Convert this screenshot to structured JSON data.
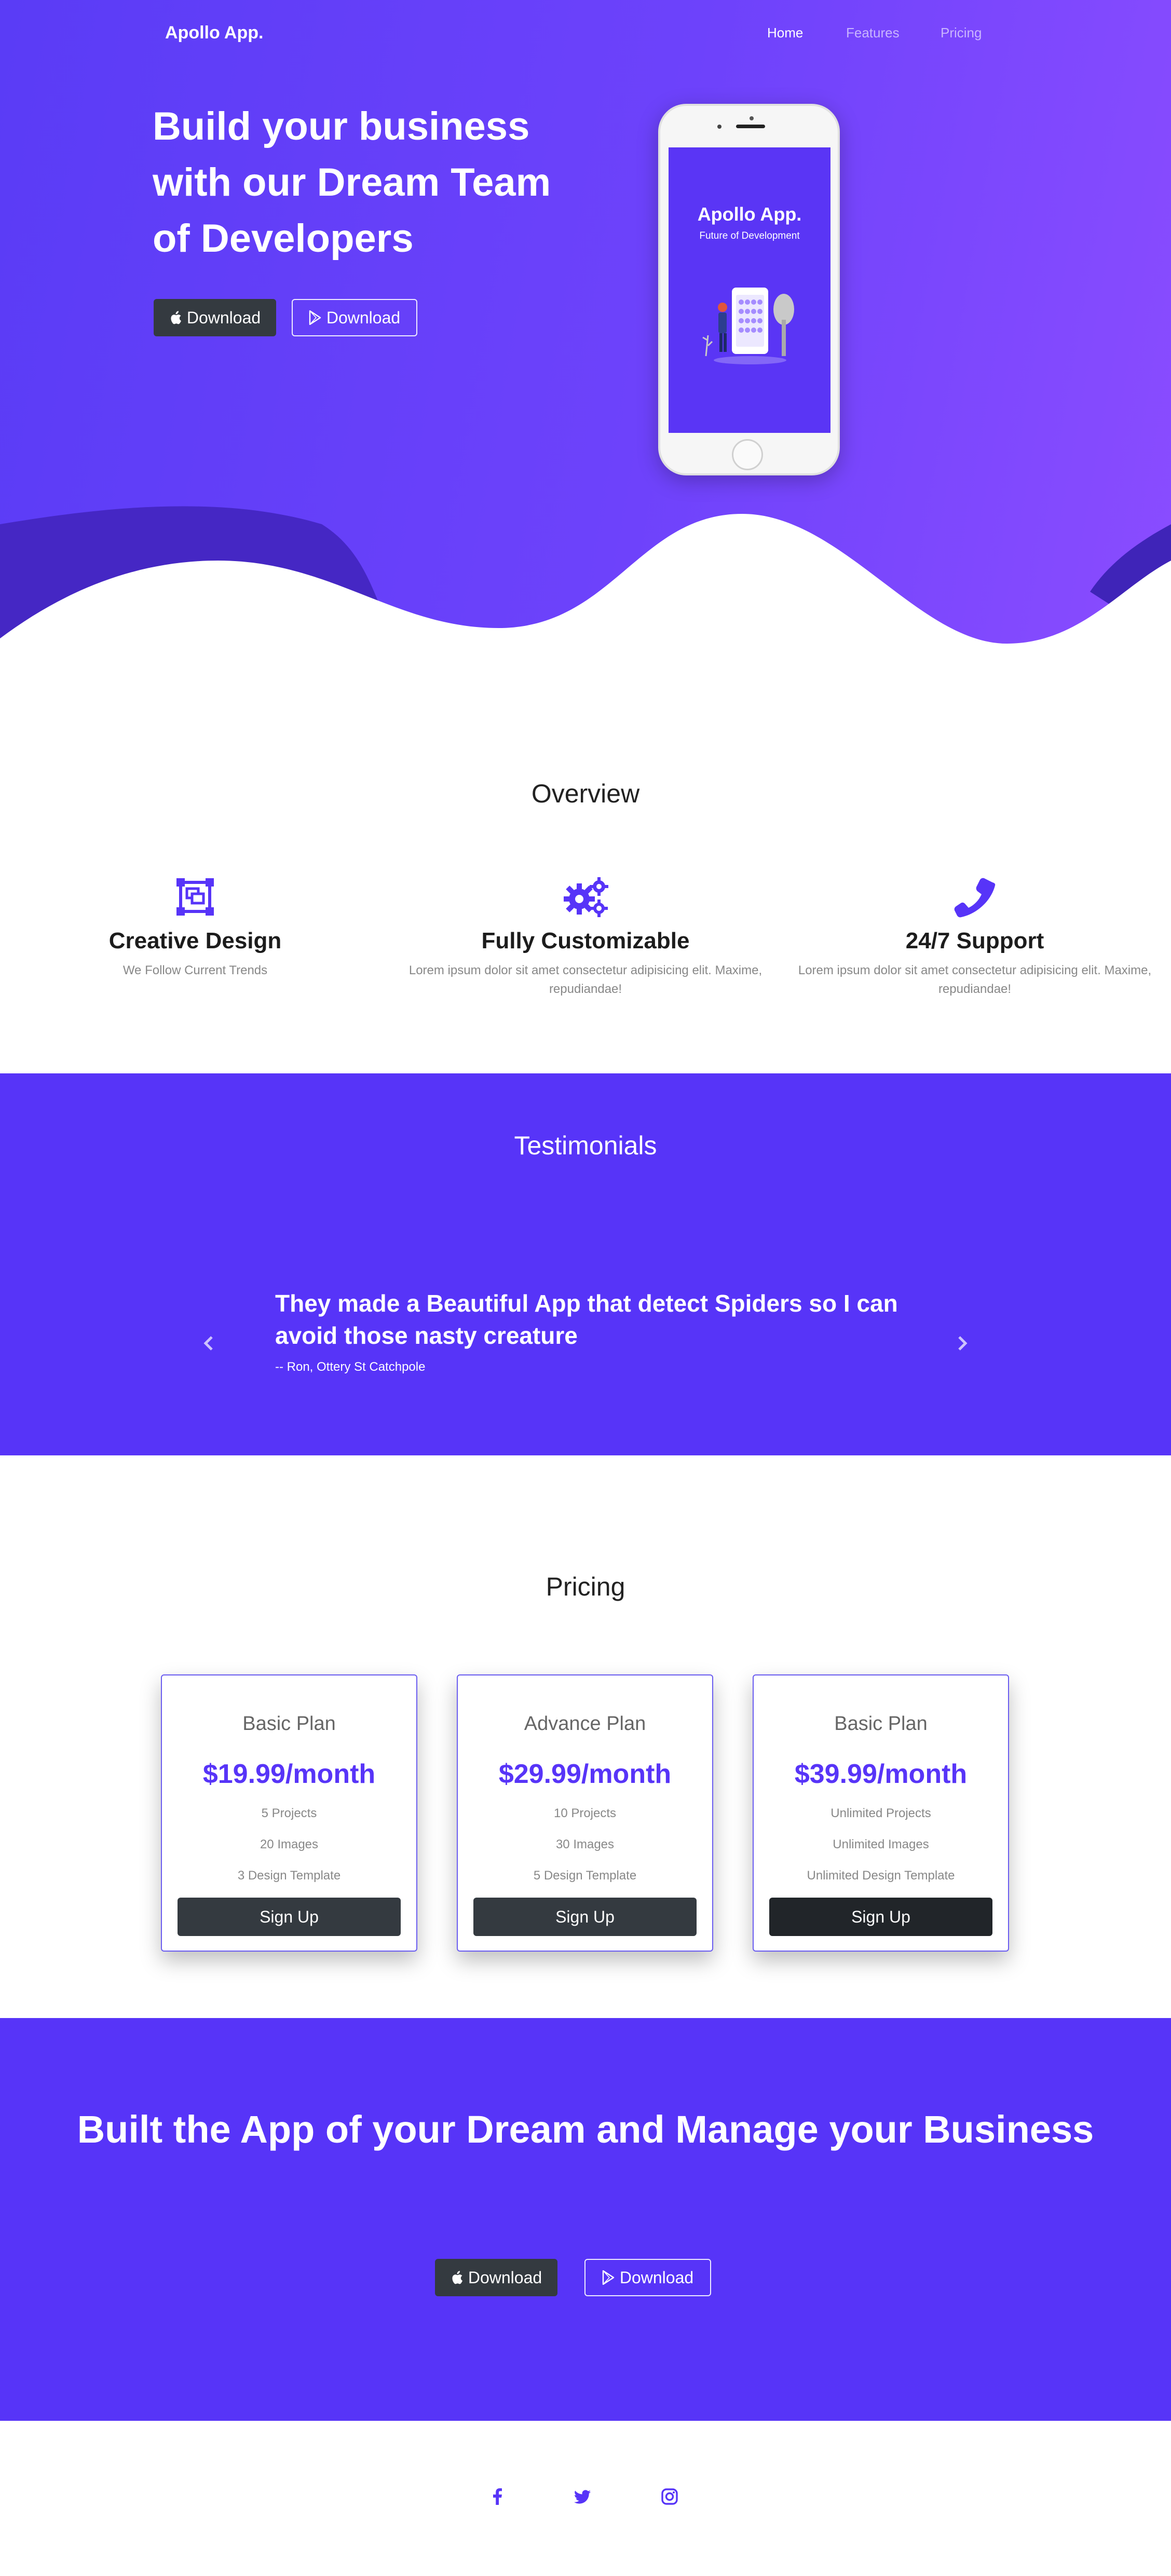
{
  "brand": "Apollo App.",
  "nav": {
    "home": "Home",
    "features": "Features",
    "pricing": "Pricing"
  },
  "hero": {
    "headline": "Build your business with our Dream Team of Developers",
    "download_apple": "Download",
    "download_play": "Download",
    "phone_title": "Apollo App.",
    "phone_subtitle": "Future of Development"
  },
  "overview": {
    "title": "Overview",
    "features": [
      {
        "icon": "design-frame-icon",
        "title": "Creative Design",
        "desc": "We Follow Current Trends"
      },
      {
        "icon": "gears-icon",
        "title": "Fully Customizable",
        "desc": "Lorem ipsum dolor sit amet consectetur adipisicing elit. Maxime, repudiandae!"
      },
      {
        "icon": "phone-icon",
        "title": "24/7 Support",
        "desc": "Lorem ipsum dolor sit amet consectetur adipisicing elit. Maxime, repudiandae!"
      }
    ]
  },
  "testimonials": {
    "title": "Testimonials",
    "quote": "They made a Beautiful App that detect Spiders so I can avoid those nasty creature",
    "author": "-- Ron, Ottery St Catchpole"
  },
  "pricing": {
    "title": "Pricing",
    "plans": [
      {
        "name": "Basic Plan",
        "price": "$19.99/month",
        "features": [
          "5 Projects",
          "20 Images",
          "3 Design Template"
        ],
        "cta": "Sign Up"
      },
      {
        "name": "Advance Plan",
        "price": "$29.99/month",
        "features": [
          "10 Projects",
          "30 Images",
          "5 Design Template"
        ],
        "cta": "Sign Up"
      },
      {
        "name": "Basic Plan",
        "price": "$39.99/month",
        "features": [
          "Unlimited Projects",
          "Unlimited Images",
          "Unlimited Design Template"
        ],
        "cta": "Sign Up"
      }
    ]
  },
  "cta": {
    "headline": "Built the App of your Dream and Manage your Business",
    "download_apple": "Download",
    "download_play": "Download"
  },
  "footer": {
    "social": [
      "facebook-icon",
      "twitter-icon",
      "instagram-icon"
    ]
  },
  "colors": {
    "primary": "#5734f8",
    "gradient_end": "#8a4cff",
    "dark_button": "#343a40"
  }
}
